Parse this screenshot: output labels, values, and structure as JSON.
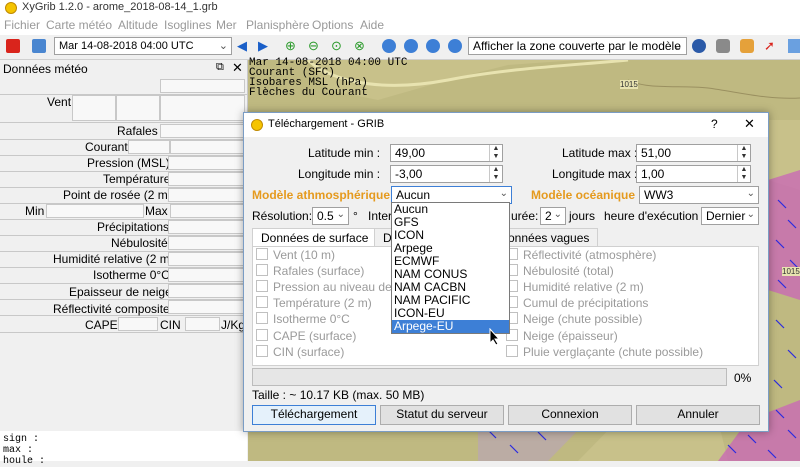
{
  "window": {
    "title": "XyGrib 1.2.0 - arome_2018-08-14_1.grb"
  },
  "menu": [
    "Fichier",
    "Carte météo",
    "Altitude",
    "Isoglines",
    "Mer",
    "Planisphère",
    "Options",
    "Aide"
  ],
  "toolbar": {
    "date": "Mar 14-08-2018 04:00 UTC",
    "zone": "Afficher la zone couverte par le modèle"
  },
  "panel": {
    "title": "Données météo",
    "rows": [
      "Vent",
      "Rafales",
      "Courant",
      "Pression (MSL)",
      "Température",
      "Point de rosée (2 m)",
      "Précipitations",
      "Nébulosité",
      "Humidité relative (2 m)",
      "Isotherme 0°C",
      "Epaisseur de neige",
      "Réflectivité composite"
    ],
    "min_label": "Min",
    "max_label": "Max",
    "cape": "CAPE",
    "cin": "CIN",
    "unit": "J/Kg"
  },
  "console": [
    "sign :",
    "max :",
    "houle :"
  ],
  "map": {
    "overlay": [
      "Mar 14-08-2018 04:00 UTC",
      "Courant (SFC)",
      "Isobares MSL (hPa)",
      "Flèches du Courant"
    ],
    "labels": [
      "1015",
      "1015"
    ]
  },
  "dialog": {
    "title": "Téléchargement - GRIB",
    "help": "?",
    "close": "✕",
    "lat_min_label": "Latitude min :",
    "lat_min": "49,00",
    "lat_max_label": "Latitude max :",
    "lat_max": "51,00",
    "lon_min_label": "Longitude min :",
    "lon_min": "-3,00",
    "lon_max_label": "Longitude max :",
    "lon_max": "1,00",
    "atmo_label": "Modèle athmosphérique :",
    "atmo_value": "Aucun",
    "ocean_label": "Modèle océanique :",
    "ocean_value": "WW3",
    "resolution_label": "Résolution:",
    "resolution_value": "0.5",
    "degree": "°",
    "interval_label": "Inter",
    "duration_label": "urée:",
    "duration_value": "2",
    "days_label": "jours",
    "run_label": "heure d'exécution :",
    "run_value": "Dernier",
    "tabs": [
      "Données de surface",
      "D",
      "onnées vagues"
    ],
    "checks_left": [
      "Vent (10 m)",
      "Rafales (surface)",
      "Pression au niveau de la",
      "Température (2 m)",
      "Isotherme 0°C",
      "CAPE (surface)",
      "CIN (surface)"
    ],
    "checks_right": [
      "Réflectivité (atmosphère)",
      "Nébulosité (total)",
      "Humidité relative (2 m)",
      "Cumul de précipitations",
      "Neige (chute possible)",
      "Neige (épaisseur)",
      "Pluie verglaçante (chute possible)"
    ],
    "progress_percent": "0%",
    "size_text": "Taille : ~ 10.17 KB (max. 50 MB)",
    "buttons": [
      "Téléchargement",
      "Statut du serveur",
      "Connexion",
      "Annuler"
    ],
    "dropdown_options": [
      "Aucun",
      "GFS",
      "ICON",
      "Arpege",
      "ECMWF",
      "NAM CONUS",
      "NAM CACBN",
      "NAM PACIFIC",
      "ICON-EU",
      "Arpege-EU"
    ],
    "dropdown_selected": "Arpege-EU"
  },
  "colors": {
    "accent": "#e59a1e",
    "selection": "#3d7fd6",
    "map_land": "#c8c18a",
    "arrow": "#2a2ae0"
  }
}
